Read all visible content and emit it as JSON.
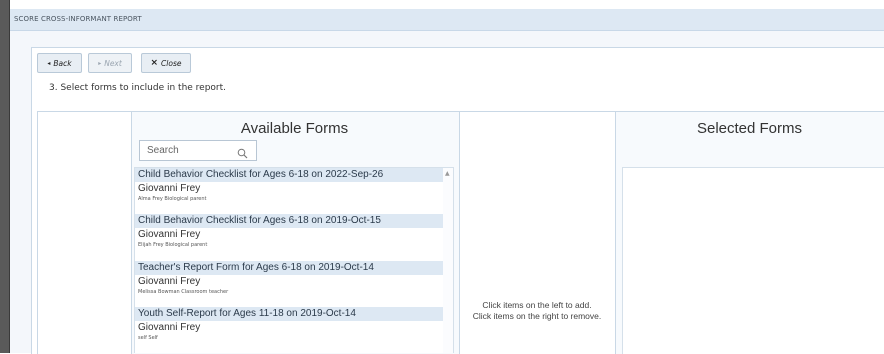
{
  "window": {
    "title": "SCORE CROSS-INFORMANT REPORT"
  },
  "nav": {
    "back_label": "Back",
    "next_label": "Next",
    "close_label": "Close"
  },
  "step_text": "3. Select forms to include in the report.",
  "available": {
    "title": "Available Forms",
    "search_placeholder": "Search",
    "items": [
      {
        "form": "Child Behavior Checklist for Ages 6-18 on 2022-Sep-26",
        "subject": "Giovanni Frey",
        "informant": "Alma Frey Biological parent"
      },
      {
        "form": "Child Behavior Checklist for Ages 6-18 on 2019-Oct-15",
        "subject": "Giovanni Frey",
        "informant": "Elijah Frey Biological parent"
      },
      {
        "form": "Teacher's Report Form for Ages 6-18 on 2019-Oct-14",
        "subject": "Giovanni Frey",
        "informant": "Melissa Bowman Classroom teacher"
      },
      {
        "form": "Youth Self-Report for Ages 11-18 on 2019-Oct-14",
        "subject": "Giovanni Frey",
        "informant": "self Self"
      }
    ]
  },
  "hint": {
    "line1": "Click items on the left to add.",
    "line2": "Click items on the right to remove."
  },
  "selected": {
    "title": "Selected Forms"
  }
}
